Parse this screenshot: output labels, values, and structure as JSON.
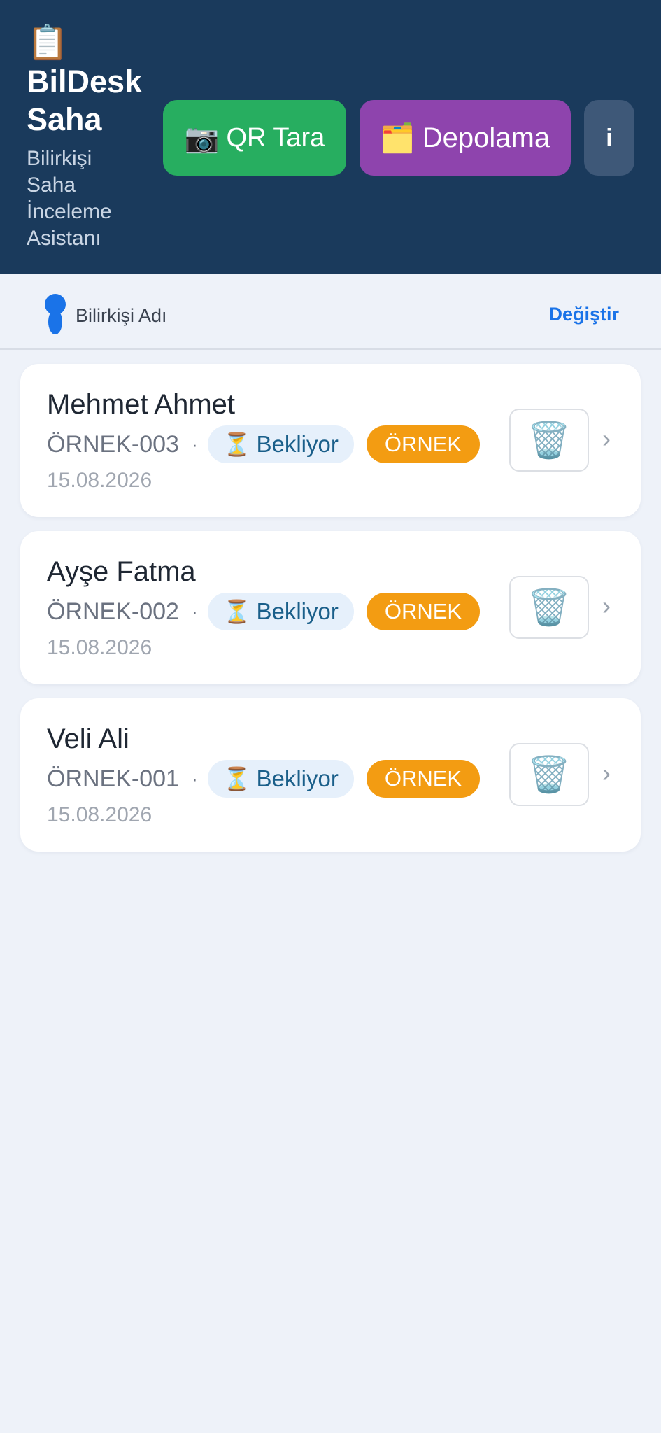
{
  "header": {
    "icon": "clipboard-icon",
    "icon_glyph": "📋",
    "title": "BilDesk Saha",
    "subtitle": "Bilirkişi Saha İnceleme Asistanı",
    "qr_button": {
      "icon": "📷",
      "label": "QR Tara",
      "color": "#27ae60"
    },
    "storage_button": {
      "icon": "🗂️",
      "label": "Depolama",
      "color": "#8e44ad"
    },
    "info_button": {
      "label": "i"
    },
    "background": "#1a3a5c"
  },
  "user": {
    "icon": "user-icon",
    "name": "Bilirkişi Adı",
    "change_label": "Değiştir"
  },
  "cases": [
    {
      "name": "Mehmet Ahmet",
      "code": "ÖRNEK-003",
      "separator": "·",
      "status_icon": "⏳",
      "status": "Bekliyor",
      "badge": "ÖRNEK",
      "date": "15.08.2026",
      "delete_icon": "🗑️",
      "chevron": "›"
    },
    {
      "name": "Ayşe Fatma",
      "code": "ÖRNEK-002",
      "separator": "·",
      "status_icon": "⏳",
      "status": "Bekliyor",
      "badge": "ÖRNEK",
      "date": "15.08.2026",
      "delete_icon": "🗑️",
      "chevron": "›"
    },
    {
      "name": "Veli Ali",
      "code": "ÖRNEK-001",
      "separator": "·",
      "status_icon": "⏳",
      "status": "Bekliyor",
      "badge": "ÖRNEK",
      "date": "15.08.2026",
      "delete_icon": "🗑️",
      "chevron": "›"
    }
  ],
  "colors": {
    "accent": "#1a73e8",
    "sample_badge": "#f39c12",
    "status_bg": "#e6f0fb"
  }
}
